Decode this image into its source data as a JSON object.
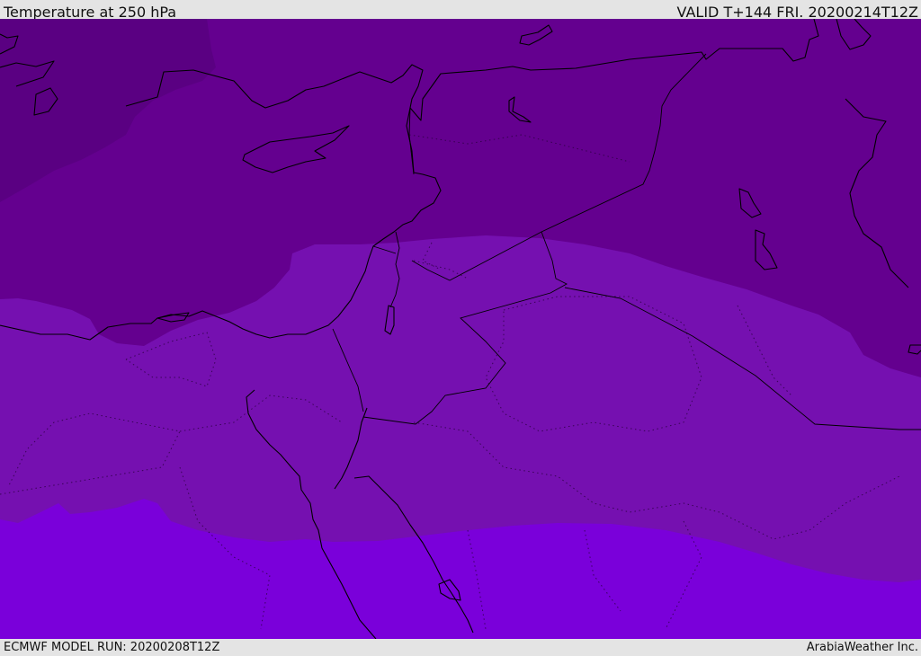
{
  "header": {
    "title": "Temperature at 250 hPa",
    "valid": "VALID T+144 FRI. 20200214T12Z"
  },
  "footer": {
    "model_run": "ECMWF MODEL RUN: 20200208T12Z",
    "credit": "ArabiaWeather Inc."
  },
  "colors": {
    "band_coldest": "#5a0082",
    "band_cold": "#64008f",
    "band_mid": "#7510b0",
    "band_warm": "#7a00da"
  }
}
